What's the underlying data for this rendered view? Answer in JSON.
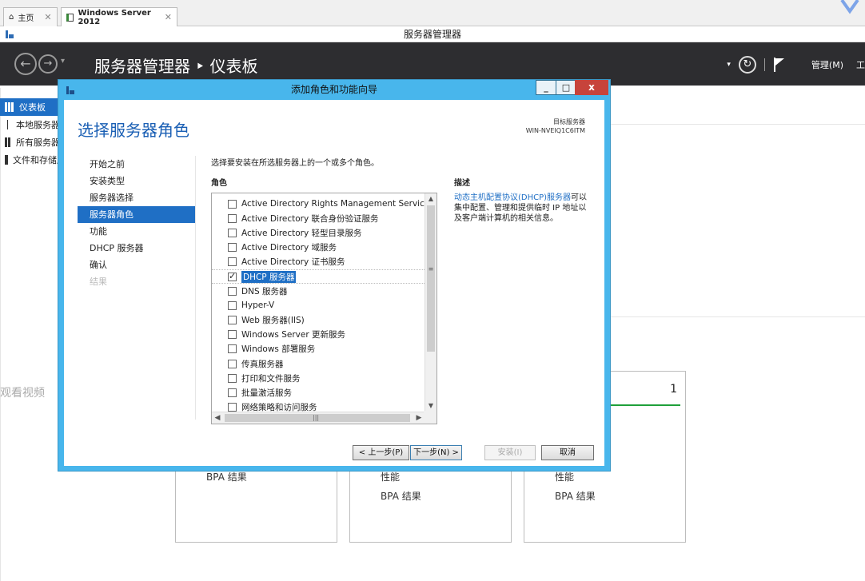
{
  "vm_tabs": [
    {
      "label": "主页",
      "active": false
    },
    {
      "label": "Windows Server 2012",
      "active": true
    }
  ],
  "app_title": "服务器管理器",
  "header": {
    "title": "服务器管理器 ‣ 仪表板",
    "manage_label": "管理(M)",
    "tools_label": "工"
  },
  "bg_nav": [
    {
      "label": "仪表板",
      "active": true
    },
    {
      "label": "本地服务器",
      "active": false
    },
    {
      "label": "所有服务器",
      "active": false
    },
    {
      "label": "文件和存储服务",
      "active": false
    }
  ],
  "watch_overlay": "观看视频",
  "tiles": [
    {
      "line1": "BPA 结果",
      "line2": "",
      "count": ""
    },
    {
      "line1": "性能",
      "line2": "BPA 结果",
      "count": ""
    },
    {
      "line1": "性能",
      "line2": "BPA 结果",
      "count": "1"
    }
  ],
  "wizard": {
    "title": "添加角色和功能向导",
    "controls": {
      "minimize": "_",
      "maximize": "□",
      "close": "x"
    },
    "page_heading": "选择服务器角色",
    "target_label": "目标服务器",
    "target_server": "WIN-NVEIQ1C6ITM",
    "steps": [
      {
        "label": "开始之前",
        "state": "normal"
      },
      {
        "label": "安装类型",
        "state": "normal"
      },
      {
        "label": "服务器选择",
        "state": "normal"
      },
      {
        "label": "服务器角色",
        "state": "active"
      },
      {
        "label": "功能",
        "state": "normal"
      },
      {
        "label": "DHCP 服务器",
        "state": "normal"
      },
      {
        "label": "确认",
        "state": "normal"
      },
      {
        "label": "结果",
        "state": "disabled"
      }
    ],
    "instruction": "选择要安装在所选服务器上的一个或多个角色。",
    "roles_header": "角色",
    "roles": [
      {
        "label": "Active Directory Rights Management Services",
        "checked": false,
        "selected": false
      },
      {
        "label": "Active Directory 联合身份验证服务",
        "checked": false,
        "selected": false
      },
      {
        "label": "Active Directory 轻型目录服务",
        "checked": false,
        "selected": false
      },
      {
        "label": "Active Directory 域服务",
        "checked": false,
        "selected": false
      },
      {
        "label": "Active Directory 证书服务",
        "checked": false,
        "selected": false
      },
      {
        "label": "DHCP 服务器",
        "checked": true,
        "selected": true
      },
      {
        "label": "DNS 服务器",
        "checked": false,
        "selected": false
      },
      {
        "label": "Hyper-V",
        "checked": false,
        "selected": false
      },
      {
        "label": "Web 服务器(IIS)",
        "checked": false,
        "selected": false
      },
      {
        "label": "Windows Server 更新服务",
        "checked": false,
        "selected": false
      },
      {
        "label": "Windows 部署服务",
        "checked": false,
        "selected": false
      },
      {
        "label": "传真服务器",
        "checked": false,
        "selected": false
      },
      {
        "label": "打印和文件服务",
        "checked": false,
        "selected": false
      },
      {
        "label": "批量激活服务",
        "checked": false,
        "selected": false
      },
      {
        "label": "网络策略和访问服务",
        "checked": false,
        "selected": false
      }
    ],
    "description_header": "描述",
    "description_link": "动态主机配置协议(DHCP)服务器",
    "description_text": "可以集中配置、管理和提供临时 IP 地址以及客户端计算机的相关信息。",
    "buttons": {
      "prev": "< 上一步(P)",
      "next": "下一步(N) >",
      "install": "安装(I)",
      "cancel": "取消"
    }
  }
}
